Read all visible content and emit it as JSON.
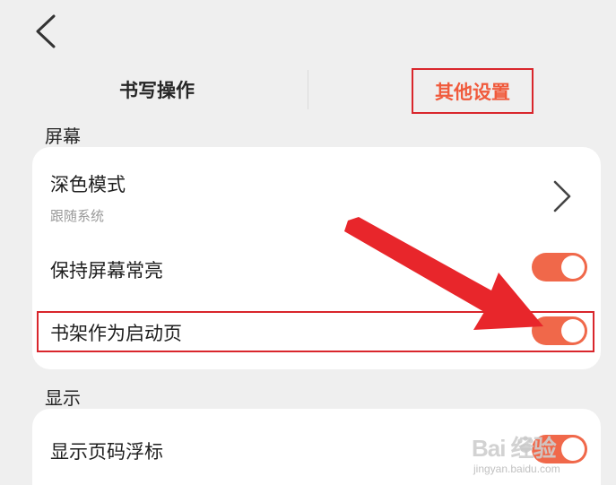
{
  "header": {
    "back_icon": "chevron-left-icon"
  },
  "tabs": [
    {
      "label": "书写操作",
      "color": "#262626"
    },
    {
      "label": "其他设置",
      "color": "#f05a3c",
      "active": true
    }
  ],
  "sections": [
    {
      "label": "屏幕",
      "rows": [
        {
          "title": "深色模式",
          "subtitle": "跟随系统",
          "control": "chevron-right-icon"
        },
        {
          "title": "保持屏幕常亮",
          "control": "toggle",
          "on": true
        },
        {
          "title": "书架作为启动页",
          "control": "toggle",
          "on": true
        }
      ]
    },
    {
      "label": "显示",
      "rows": [
        {
          "title": "显示页码浮标",
          "control": "toggle",
          "on": true
        }
      ]
    }
  ],
  "colors": {
    "accent": "#f05a3c",
    "toggle_on": "#f0684a",
    "annotation_red": "#d9262c",
    "background": "#efefef",
    "card": "#ffffff"
  },
  "watermark": {
    "logo": "Bai 经验",
    "url": "jingyan.baidu.com"
  }
}
